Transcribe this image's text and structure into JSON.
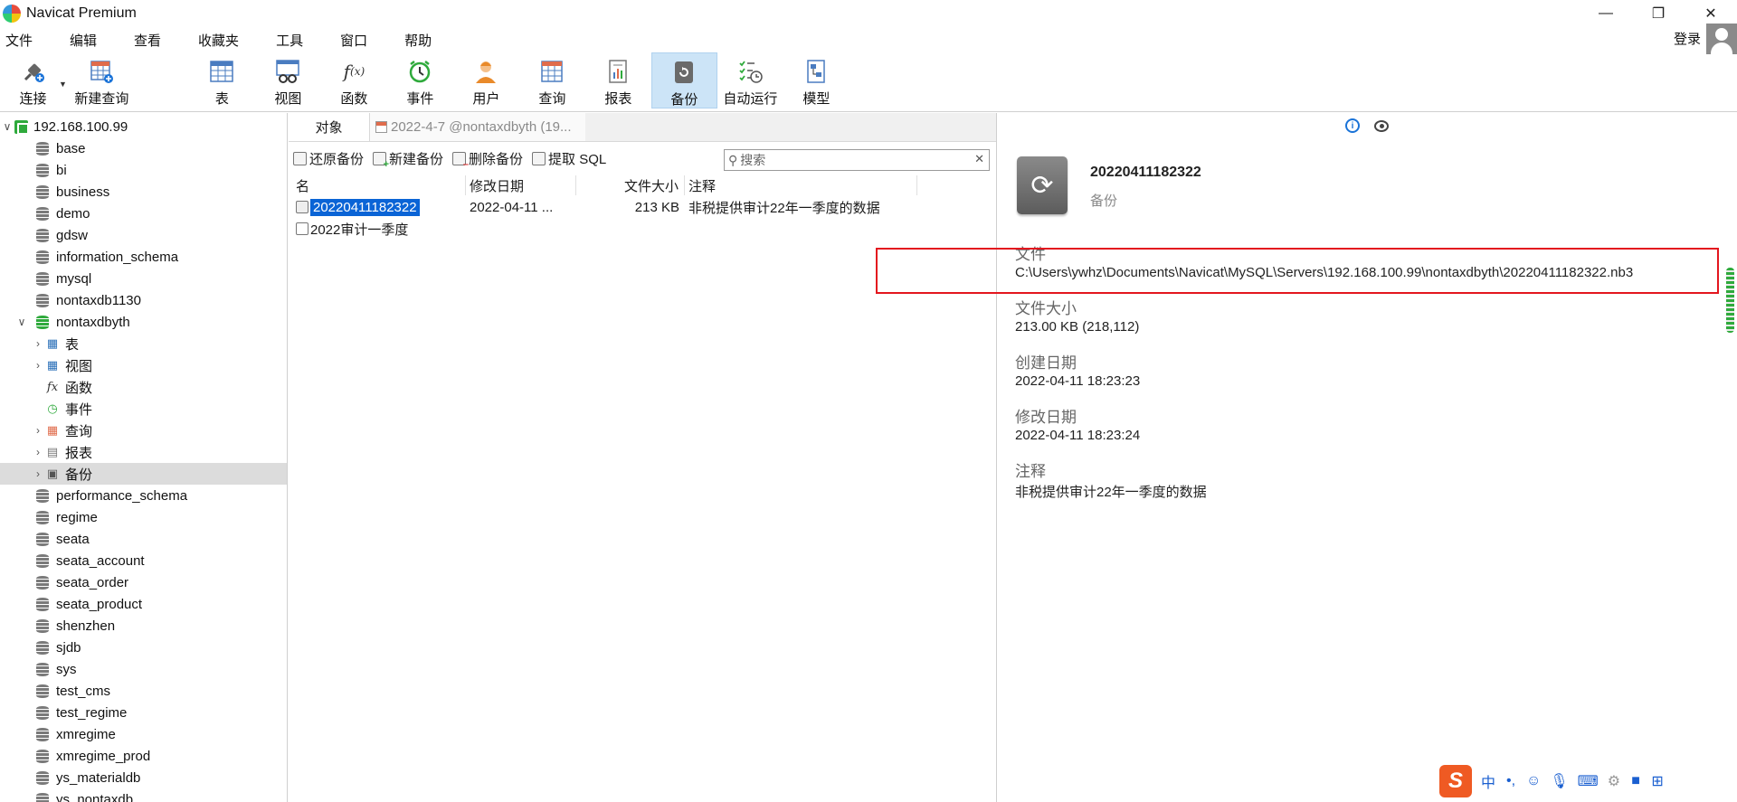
{
  "window": {
    "title": "Navicat Premium"
  },
  "menu": [
    "文件",
    "编辑",
    "查看",
    "收藏夹",
    "工具",
    "窗口",
    "帮助"
  ],
  "account": {
    "login_label": "登录"
  },
  "toolbar": {
    "connect": "连接",
    "new_query": "新建查询",
    "table": "表",
    "view": "视图",
    "function": "函数",
    "event": "事件",
    "user": "用户",
    "query": "查询",
    "report": "报表",
    "backup": "备份",
    "autorun": "自动运行",
    "model": "模型"
  },
  "tree": {
    "server": "192.168.100.99",
    "databases_top": [
      "base",
      "bi",
      "business",
      "demo",
      "gdsw",
      "information_schema",
      "mysql",
      "nontaxdb1130"
    ],
    "open_db": "nontaxdbyth",
    "open_children": {
      "table": "表",
      "view": "视图",
      "function": "函数",
      "event": "事件",
      "query": "查询",
      "report": "报表",
      "backup": "备份"
    },
    "databases_bottom": [
      "performance_schema",
      "regime",
      "seata",
      "seata_account",
      "seata_order",
      "seata_product",
      "shenzhen",
      "sjdb",
      "sys",
      "test_cms",
      "test_regime",
      "xmregime",
      "xmregime_prod",
      "ys_materialdb",
      "ys_nontaxdb"
    ]
  },
  "tabs": {
    "objects": "对象",
    "doc": "2022-4-7 @nontaxdbyth (19..."
  },
  "actions": {
    "restore": "还原备份",
    "new": "新建备份",
    "delete": "删除备份",
    "extract": "提取 SQL"
  },
  "search": {
    "placeholder": "搜索"
  },
  "columns": {
    "name": "名",
    "modified": "修改日期",
    "size": "文件大小",
    "comment": "注释"
  },
  "rows": [
    {
      "name": "20220411182322",
      "modified": "2022-04-11 ...",
      "size": "213 KB",
      "comment": "非税提供审计22年一季度的数据"
    },
    {
      "name": "2022审计一季度",
      "modified": "",
      "size": "",
      "comment": ""
    }
  ],
  "detail": {
    "title": "20220411182322",
    "subtitle": "备份",
    "file_label": "文件",
    "file_value": "C:\\Users\\ywhz\\Documents\\Navicat\\MySQL\\Servers\\192.168.100.99\\nontaxdbyth\\20220411182322.nb3",
    "size_label": "文件大小",
    "size_value": "213.00 KB (218,112)",
    "created_label": "创建日期",
    "created_value": "2022-04-11 18:23:23",
    "modified_label": "修改日期",
    "modified_value": "2022-04-11 18:23:24",
    "comment_label": "注释",
    "comment_value": "非税提供审计22年一季度的数据"
  },
  "ime": {
    "lang": "中",
    "punct": "•,"
  }
}
